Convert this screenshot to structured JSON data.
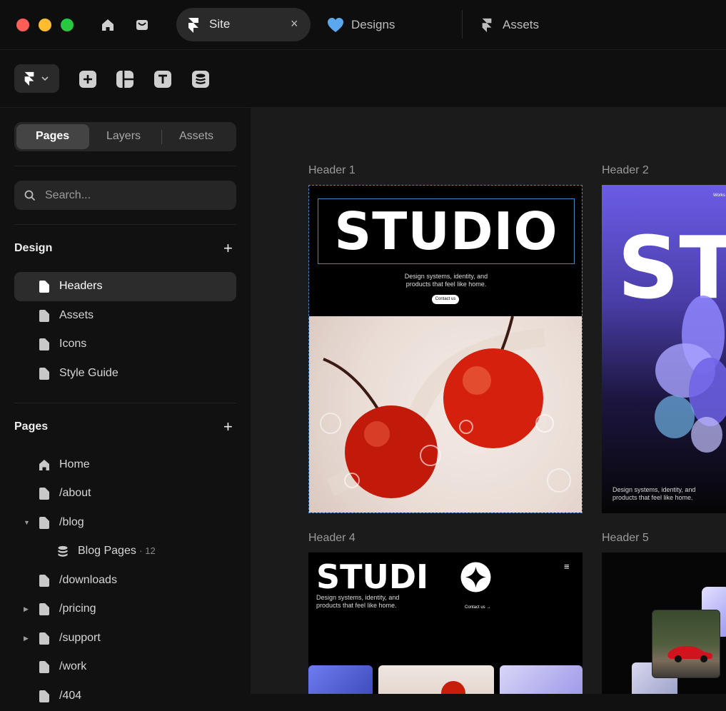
{
  "titlebar": {
    "tabs": [
      {
        "label": "Site",
        "active": true
      },
      {
        "label": "Designs",
        "active": false
      },
      {
        "label": "Assets",
        "active": false
      }
    ],
    "close_symbol": "×"
  },
  "toolbar": {
    "icons": [
      "framer-logo-icon",
      "insert-icon",
      "layout-icon",
      "text-icon",
      "cms-icon"
    ]
  },
  "sidebar": {
    "segments": [
      "Pages",
      "Layers",
      "Assets"
    ],
    "active_segment": "Pages",
    "search_placeholder": "Search...",
    "design_title": "Design",
    "design_items": [
      {
        "label": "Headers",
        "selected": true
      },
      {
        "label": "Assets",
        "selected": false
      },
      {
        "label": "Icons",
        "selected": false
      },
      {
        "label": "Style Guide",
        "selected": false
      }
    ],
    "pages_title": "Pages",
    "pages_items": [
      {
        "label": "Home",
        "icon": "home-icon"
      },
      {
        "label": "/about",
        "icon": "page-icon"
      },
      {
        "label": "/blog",
        "icon": "page-icon",
        "expanded": true
      },
      {
        "label": "Blog Pages",
        "icon": "cms-icon",
        "count": "12",
        "child": true
      },
      {
        "label": "/downloads",
        "icon": "page-icon"
      },
      {
        "label": "/pricing",
        "icon": "page-icon",
        "collapsed": true
      },
      {
        "label": "/support",
        "icon": "page-icon",
        "collapsed": true
      },
      {
        "label": "/work",
        "icon": "page-icon"
      },
      {
        "label": "/404",
        "icon": "page-icon"
      }
    ]
  },
  "canvas": {
    "frames": [
      {
        "label": "Header 1",
        "headline": "STUDIO",
        "tagline_1": "Design systems, identity, and",
        "tagline_2": "products that feel like home.",
        "cta": "Contact us"
      },
      {
        "label": "Header 2",
        "headline": "STU",
        "tagline_1": "Design systems, identity, and",
        "tagline_2": "products that feel like home.",
        "corner_link": "Works"
      },
      {
        "label": "Header 4",
        "headline": "STUDI",
        "tagline_1": "Design systems, identity, and",
        "tagline_2": "products that feel like home.",
        "cta": "Contact us →",
        "menu_symbol": "≡"
      },
      {
        "label": "Header 5"
      }
    ]
  },
  "colors": {
    "window_bg": "#111111",
    "canvas_bg": "#1b1b1b",
    "selection": "#4a86c7",
    "traffic_red": "#ff5f57",
    "traffic_yellow": "#febc2e",
    "traffic_green": "#28c840",
    "heart": "#5aa8f0"
  }
}
